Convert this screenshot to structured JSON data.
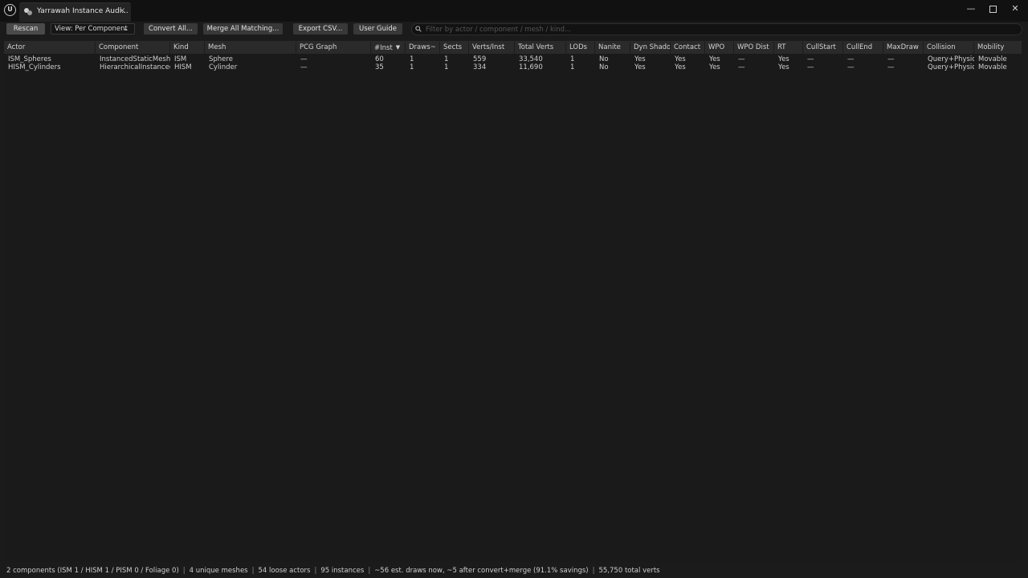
{
  "window": {
    "tab_title": "Yarrawah Instance Audi...",
    "tab_close": "×",
    "minimize": "—",
    "close": "✕"
  },
  "toolbar": {
    "rescan_label": "Rescan",
    "view_label": "View: Per Component",
    "convert_label": "Convert All...",
    "merge_label": "Merge All Matching...",
    "export_label": "Export CSV...",
    "guide_label": "User Guide",
    "search_placeholder": "Filter by actor / component / mesh / kind..."
  },
  "table": {
    "columns": [
      "Actor",
      "Component",
      "Kind",
      "Mesh",
      "PCG Graph",
      "#Inst",
      "Draws~",
      "Sects",
      "Verts/Inst",
      "Total Verts",
      "LODs",
      "Nanite",
      "Dyn Shadow",
      "Contact",
      "WPO",
      "WPO Dist",
      "RT",
      "CullStart",
      "CullEnd",
      "MaxDraw",
      "Collision",
      "Mobility"
    ],
    "sort_column": "#Inst",
    "rows": [
      [
        "ISM_Spheres",
        "InstancedStaticMesh",
        "ISM",
        "Sphere",
        "—",
        "60",
        "1",
        "1",
        "559",
        "33,540",
        "1",
        "No",
        "Yes",
        "Yes",
        "Yes",
        "—",
        "Yes",
        "—",
        "—",
        "—",
        "Query+Physics",
        "Movable"
      ],
      [
        "HISM_Cylinders",
        "HierarchicalInstancedS",
        "HISM",
        "Cylinder",
        "—",
        "35",
        "1",
        "1",
        "334",
        "11,690",
        "1",
        "No",
        "Yes",
        "Yes",
        "Yes",
        "—",
        "Yes",
        "—",
        "—",
        "—",
        "Query+Physics",
        "Movable"
      ]
    ]
  },
  "status": {
    "components": "2 components  (ISM 1 / HISM 1 / PISM 0 / Foliage 0)",
    "meshes": "4 unique meshes",
    "loose": "54 loose actors",
    "instances": "95 instances",
    "draws": "~56 est. draws now, ~5 after convert+merge (91.1% savings)",
    "verts": "55,750 total verts",
    "separator": "|"
  }
}
